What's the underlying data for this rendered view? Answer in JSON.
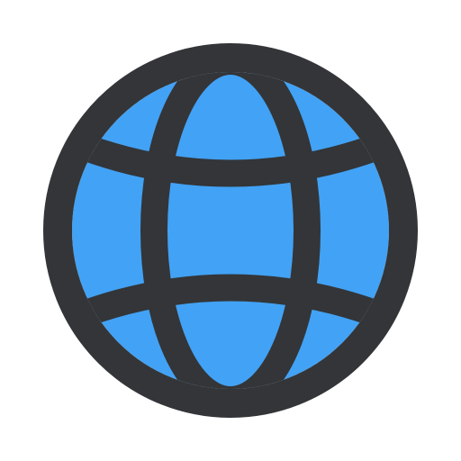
{
  "icon": {
    "name": "globe-icon",
    "fill_color": "#42A2F5",
    "stroke_color": "#333538",
    "background_color": "#FFFFFF"
  }
}
